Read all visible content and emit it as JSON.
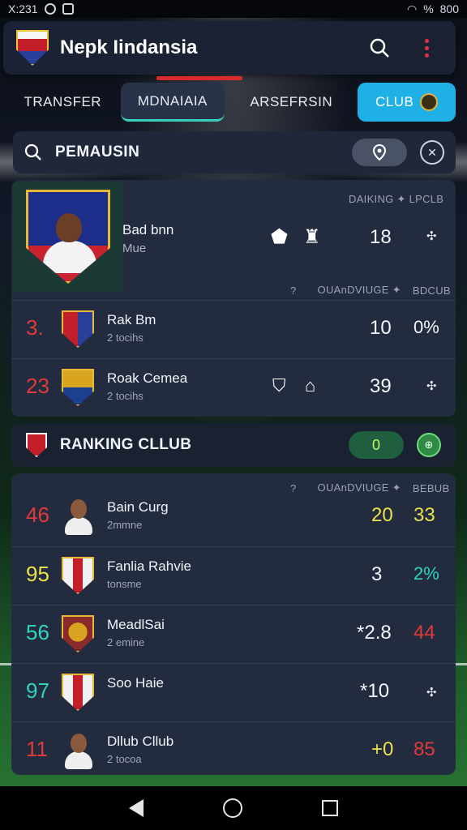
{
  "status_bar": {
    "time": "X:231",
    "battery": "800",
    "signal": "%"
  },
  "header": {
    "title": "Nepk Iindansia"
  },
  "tabs": [
    {
      "label": "TRANSFER"
    },
    {
      "label": "MDNAIAIA"
    },
    {
      "label": "ARSEFRSIN"
    },
    {
      "label": "CLUB"
    }
  ],
  "search": {
    "label": "PEMAUSIN"
  },
  "top_panel": {
    "featured": {
      "name": "Bad bnn",
      "subtitle": "Mue",
      "col_head": "DAIKING ✦ LPCLB",
      "value": "18",
      "extra": "✣"
    },
    "col_head_2": {
      "left": "?",
      "mid": "OUAnDVIUGE ✦",
      "right": "BDCUB"
    },
    "rows": [
      {
        "rank": "3.",
        "rank_color": "#e03b3b",
        "name": "Rak Bm",
        "sub": "2 tocihs",
        "value": "10",
        "extra": "0%",
        "crest_colors": [
          "#c21f2b",
          "#2a3f99"
        ]
      },
      {
        "rank": "23",
        "rank_color": "#e03b3b",
        "name": "Roak Cemea",
        "sub": "2 tocihs",
        "value": "39",
        "extra": "✣",
        "crest_colors": [
          "#d9a521",
          "#1d3f8f"
        ]
      }
    ]
  },
  "ranking_section": {
    "title": "RANKING CLLUB",
    "pill": "0",
    "round": "⊕"
  },
  "bottom_panel": {
    "col_head": {
      "left": "?",
      "mid": "OUAnDVIUGE ✦",
      "right": "BEBUB"
    },
    "rows": [
      {
        "rank": "46",
        "rank_color": "#e03b3b",
        "type": "face",
        "name": "Bain Curg",
        "sub": "2mmne",
        "value": "20",
        "value_color": "#e9e34a",
        "extra": "33",
        "extra_color": "#e9e34a"
      },
      {
        "rank": "95",
        "rank_color": "#e9e34a",
        "type": "crest",
        "crest_colors": [
          "#f1f1f1",
          "#c21f2b"
        ],
        "name": "Fanlia Rahvie",
        "sub": "tonsme",
        "value": "3",
        "value_color": "#f1f4fa",
        "extra": "2%",
        "extra_color": "#2fd4c0"
      },
      {
        "rank": "56",
        "rank_color": "#2fd4c0",
        "type": "crest",
        "crest_colors": [
          "#d9a521",
          "#8b2a2a"
        ],
        "name": "MeadlSai",
        "sub": "2 emine",
        "value": "*2.8",
        "value_color": "#f1f4fa",
        "extra": "44",
        "extra_color": "#e03b3b"
      },
      {
        "rank": "97",
        "rank_color": "#2fd4c0",
        "type": "crest",
        "crest_colors": [
          "#f1f1f1",
          "#c21f2b"
        ],
        "name": "Soo Haie",
        "sub": "",
        "value": "*10",
        "value_color": "#f1f4fa",
        "extra": "✣",
        "extra_color": "#e3e7ef"
      },
      {
        "rank": "11",
        "rank_color": "#e03b3b",
        "type": "face",
        "name": "Dllub Cllub",
        "sub": "2 tocoa",
        "value": "+0",
        "value_color": "#e9e34a",
        "extra": "85",
        "extra_color": "#e03b3b"
      }
    ]
  },
  "colors": {
    "accent": "#1fb0e6",
    "active_tab_underline": "#39d0b9",
    "panel": "#232b3e"
  }
}
